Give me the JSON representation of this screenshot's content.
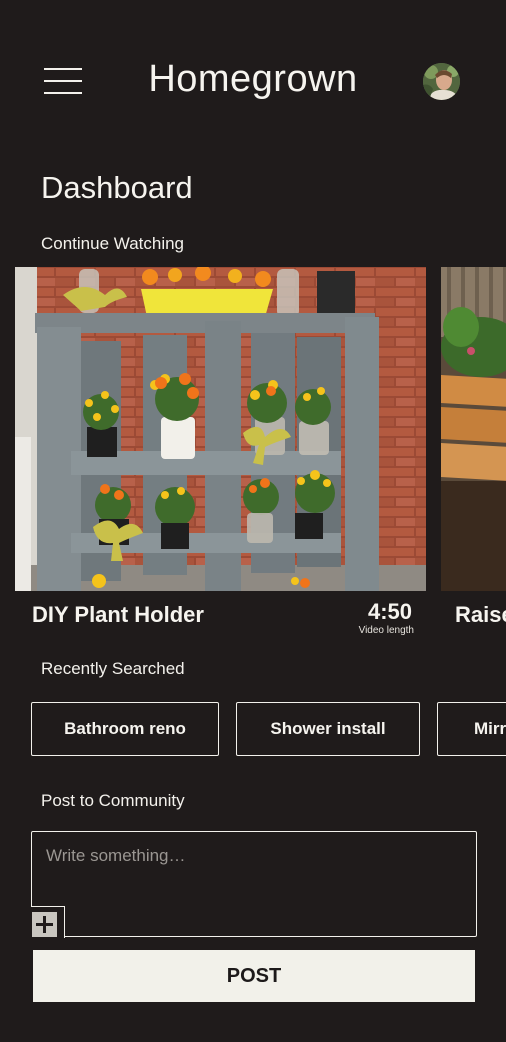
{
  "header": {
    "app_title": "Homegrown",
    "menu_icon": "hamburger-menu-icon",
    "avatar_icon": "user-avatar"
  },
  "page": {
    "title": "Dashboard"
  },
  "continue_watching": {
    "label": "Continue Watching",
    "videos": [
      {
        "title": "DIY Plant Holder",
        "length": "4:50",
        "length_label": "Video length"
      },
      {
        "title": "Raised Garden Bed"
      }
    ]
  },
  "recently_searched": {
    "label": "Recently Searched",
    "items": [
      "Bathroom reno",
      "Shower install",
      "Mirror"
    ]
  },
  "community": {
    "label": "Post to Community",
    "placeholder": "Write something…",
    "attach_icon": "plus-icon",
    "post_label": "POST"
  },
  "colors": {
    "background": "#1f1b1b",
    "text": "#f3f1ec",
    "button_bg": "#f2f1ea"
  }
}
